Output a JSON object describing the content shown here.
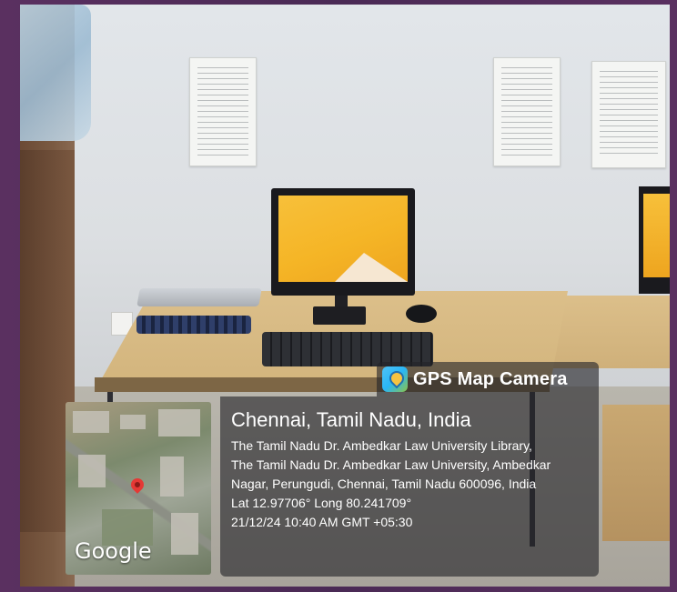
{
  "overlay": {
    "brand": "GPS Map Camera",
    "brand_icon": "gps-map-camera-icon",
    "city": "Chennai, Tamil Nadu, India",
    "address_line1": "The Tamil Nadu Dr. Ambedkar Law University Library,",
    "address_line2": "The Tamil Nadu Dr. Ambedkar Law University, Ambedkar",
    "address_line3": "Nagar, Perungudi, Chennai, Tamil Nadu 600096, India",
    "coordinates": "Lat 12.97706° Long 80.241709°",
    "timestamp": "21/12/24 10:40 AM GMT +05:30",
    "map_watermark": "Google",
    "pin_icon": "map-pin-icon",
    "colors": {
      "panel_bg": "#232328",
      "pin": "#e53935",
      "screen": "#f5b526"
    }
  }
}
